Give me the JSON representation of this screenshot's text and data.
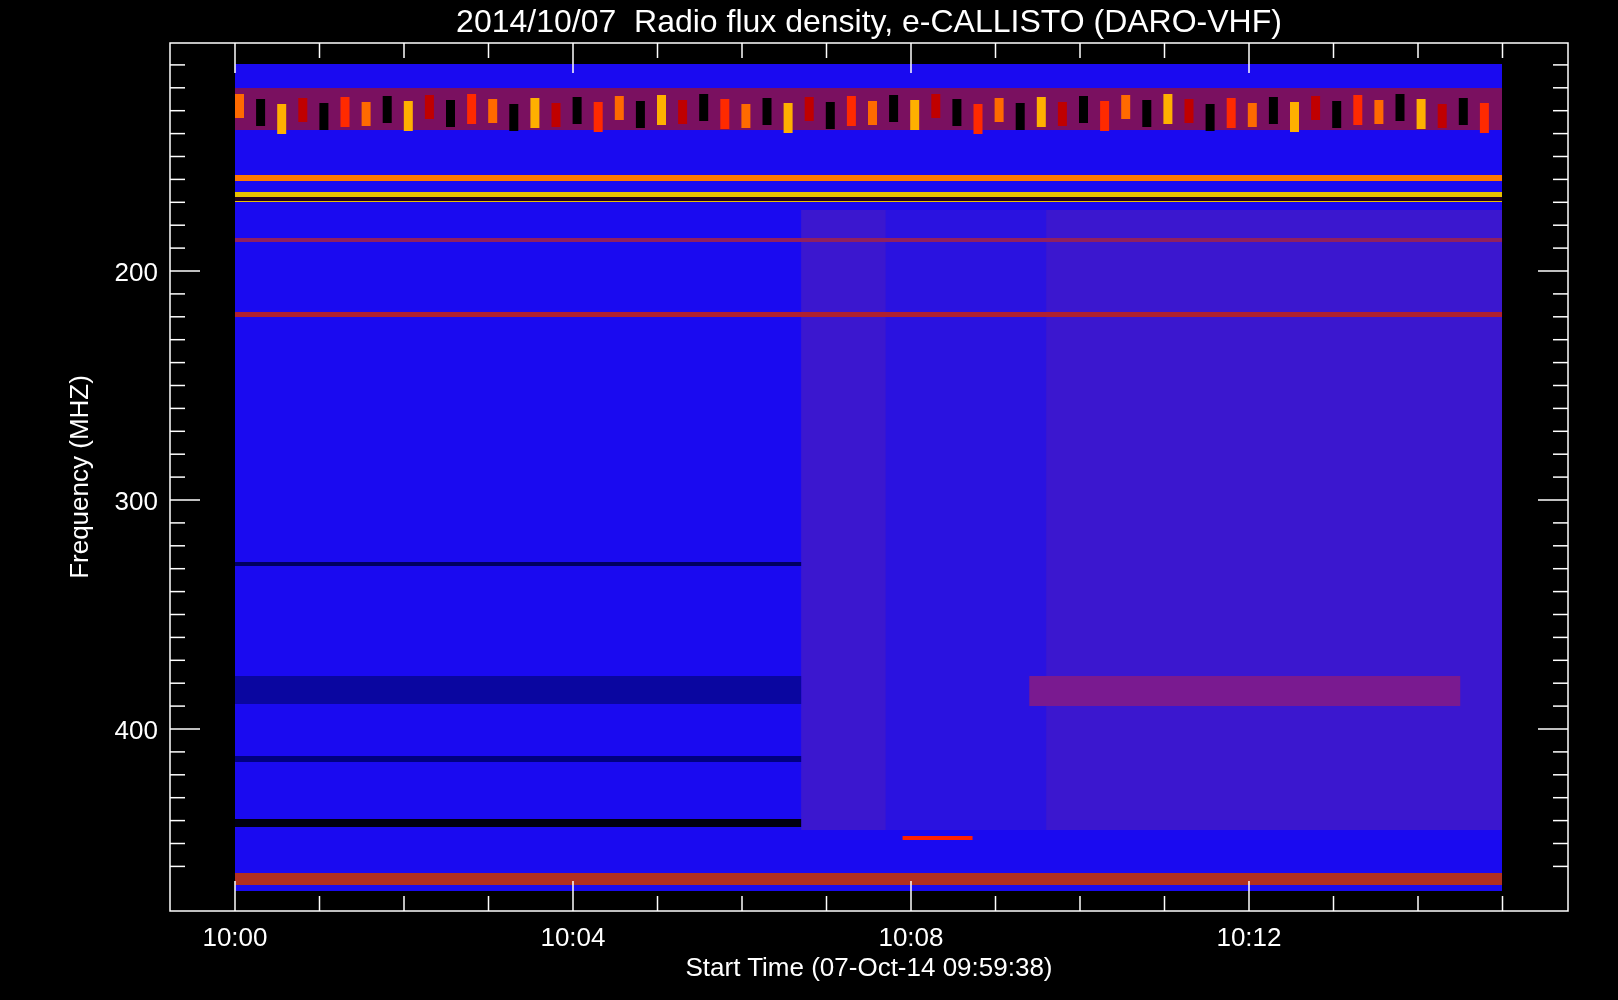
{
  "title": "2014/10/07  Radio flux density, e-CALLISTO (DARO-VHF)",
  "y_axis": {
    "label": "Frequency (MHZ)",
    "ticks": [
      "200",
      "300",
      "400"
    ]
  },
  "x_axis": {
    "label": "Start Time (07-Oct-14 09:59:38)",
    "ticks": [
      "10:00",
      "10:04",
      "10:08",
      "10:12"
    ]
  }
}
